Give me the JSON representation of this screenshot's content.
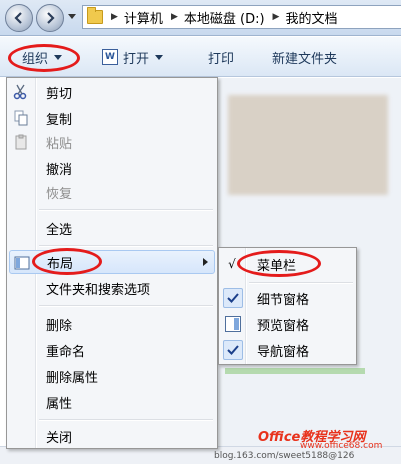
{
  "address_bar": {
    "breadcrumbs": [
      "计算机",
      "本地磁盘 (D:)",
      "我的文档"
    ]
  },
  "toolbar": {
    "organize": "组织",
    "open": "打开",
    "print": "打印",
    "new_folder": "新建文件夹",
    "open_icon_letter": "W"
  },
  "menu": {
    "cut": "剪切",
    "copy": "复制",
    "paste": "粘贴",
    "undo": "撤消",
    "redo": "恢复",
    "select_all": "全选",
    "layout": "布局",
    "folder_options": "文件夹和搜索选项",
    "delete": "删除",
    "rename": "重命名",
    "remove_properties": "删除属性",
    "properties": "属性",
    "close": "关闭"
  },
  "layout_submenu": {
    "menu_bar": "菜单栏",
    "details_pane": "细节窗格",
    "preview_pane": "预览窗格",
    "navigation_pane": "导航窗格",
    "check_mark": "√"
  },
  "watermark": {
    "brand": "Office教程学习网",
    "url": "www.office68.com",
    "blog": "blog.163.com/sweet5188@126"
  },
  "colors": {
    "highlight_ring": "#e41b1b",
    "watermark": "#e8321c",
    "toolbar_text": "#1e395b"
  }
}
